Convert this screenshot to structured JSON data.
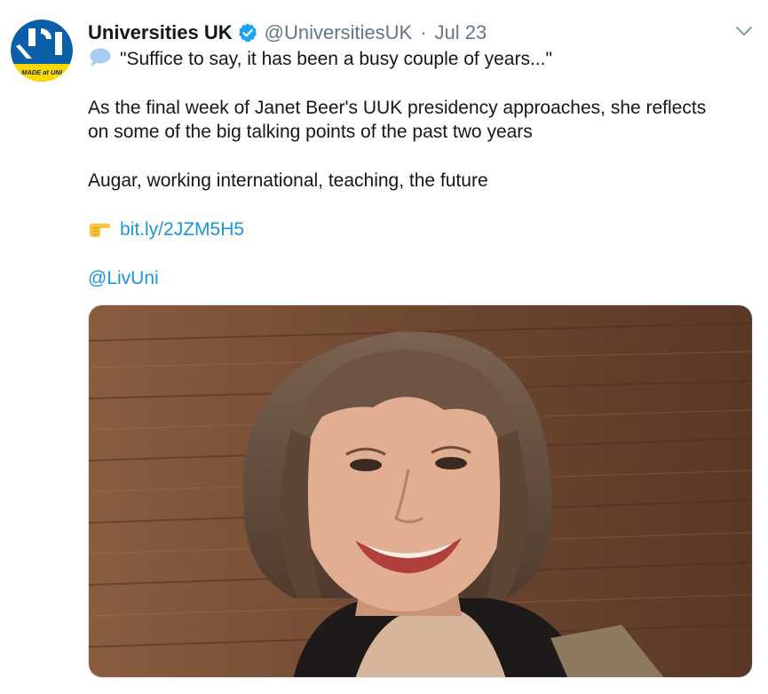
{
  "account": {
    "display_name": "Universities UK",
    "handle": "@UniversitiesUK",
    "separator": "·",
    "date": "Jul 23",
    "avatar_text": "MADE at UNI",
    "verified_icon": "verified-badge-icon"
  },
  "tweet": {
    "quote_line": "\"Suffice to say, it has been a busy couple of years...\"",
    "body_line_1": "As the final week of Janet Beer's UUK presidency approaches, she reflects",
    "body_line_2": "on some of the big talking points of the past two years",
    "topics": "Augar, working international, teaching, the future",
    "link": "bit.ly/2JZM5H5",
    "mention": "@LivUni"
  },
  "icons": {
    "quote_icon": "speech-bubble-icon",
    "link_icon": "pointing-hand-icon",
    "menu_icon": "chevron-down-icon"
  },
  "colors": {
    "link": "#1b95e0",
    "verified": "#1da1f2",
    "brand_blue": "#0b5ea8",
    "brand_yellow": "#ffd700"
  }
}
